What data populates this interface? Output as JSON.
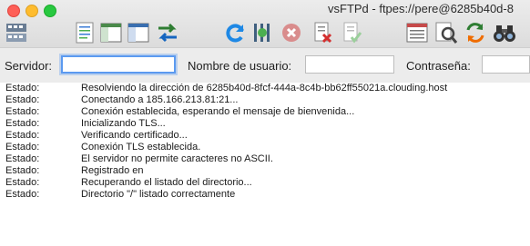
{
  "window": {
    "title": "vsFTPd - ftpes://pere@6285b40d-8"
  },
  "toolbar": {
    "icons": [
      "site-manager-icon",
      "message-log-icon",
      "local-tree-icon",
      "remote-tree-icon",
      "transfer-queue-icon",
      "refresh-icon",
      "process-queue-icon",
      "cancel-icon",
      "disconnect-icon",
      "reconnect-icon",
      "directory-listing-filter-icon",
      "search-icon",
      "sync-browsing-icon",
      "binoculars-icon"
    ]
  },
  "quickconnect": {
    "host_label": "Servidor:",
    "host_value": "",
    "user_label": "Nombre de usuario:",
    "user_value": "",
    "pass_label": "Contraseña:",
    "pass_value": ""
  },
  "log": [
    {
      "label": "Estado:",
      "message": "Resolviendo la dirección de 6285b40d-8fcf-444a-8c4b-bb62ff55021a.clouding.host"
    },
    {
      "label": "Estado:",
      "message": "Conectando a 185.166.213.81:21..."
    },
    {
      "label": "Estado:",
      "message": "Conexión establecida, esperando el mensaje de bienvenida..."
    },
    {
      "label": "Estado:",
      "message": "Inicializando TLS..."
    },
    {
      "label": "Estado:",
      "message": "Verificando certificado..."
    },
    {
      "label": "Estado:",
      "message": "Conexión TLS establecida."
    },
    {
      "label": "Estado:",
      "message": "El servidor no permite caracteres no ASCII."
    },
    {
      "label": "Estado:",
      "message": "Registrado en"
    },
    {
      "label": "Estado:",
      "message": "Recuperando el listado del directorio..."
    },
    {
      "label": "Estado:",
      "message": "Directorio \"/\" listado correctamente"
    }
  ]
}
